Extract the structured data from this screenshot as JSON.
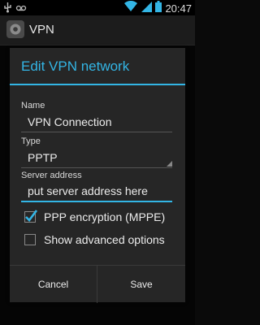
{
  "status_bar": {
    "time": "20:47",
    "icons": [
      "usb-icon",
      "voicemail-icon",
      "wifi-icon",
      "signal-icon",
      "battery-icon"
    ]
  },
  "action_bar": {
    "title": "VPN",
    "icon": "settings-gear-icon"
  },
  "dialog": {
    "title": "Edit VPN network",
    "name": {
      "label": "Name",
      "value": "VPN Connection"
    },
    "type": {
      "label": "Type",
      "value": "PPTP"
    },
    "server": {
      "label": "Server address",
      "value": "put server address here"
    },
    "ppp_encryption": {
      "label": "PPP encryption (MPPE)",
      "checked": true
    },
    "advanced": {
      "label": "Show advanced options",
      "checked": false
    },
    "buttons": {
      "cancel": "Cancel",
      "save": "Save"
    }
  },
  "colors": {
    "accent": "#33b5e5",
    "dialog_bg": "#262626"
  }
}
